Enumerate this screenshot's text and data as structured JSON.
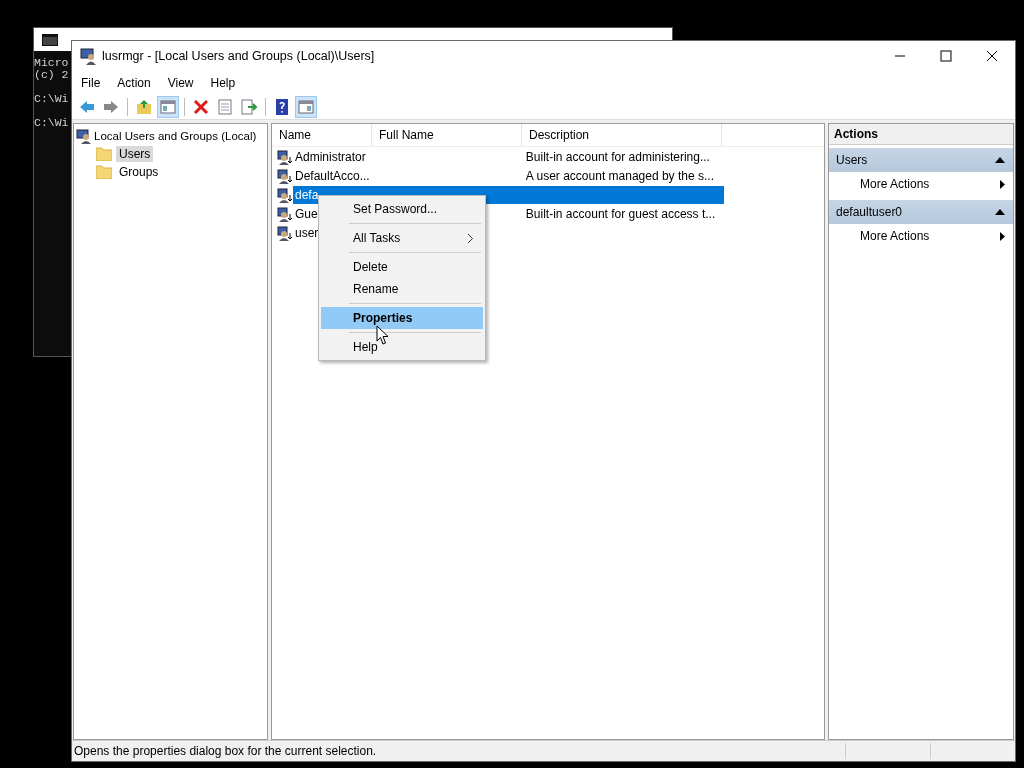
{
  "console_window": {
    "lines": [
      "Micro",
      "(c) 2",
      "C:\\Wi",
      "C:\\Wi"
    ]
  },
  "window": {
    "title": "lusrmgr - [Local Users and Groups (Local)\\Users]"
  },
  "menu_bar": [
    "File",
    "Action",
    "View",
    "Help"
  ],
  "toolbar": [
    {
      "kind": "back",
      "on": false
    },
    {
      "kind": "forward",
      "on": false
    },
    {
      "kind": "separator"
    },
    {
      "kind": "up",
      "on": false
    },
    {
      "kind": "tree-pane",
      "on": true
    },
    {
      "kind": "separator"
    },
    {
      "kind": "delete",
      "on": false
    },
    {
      "kind": "properties",
      "on": false
    },
    {
      "kind": "export",
      "on": false
    },
    {
      "kind": "separator"
    },
    {
      "kind": "help",
      "on": false
    },
    {
      "kind": "action-pane",
      "on": true
    }
  ],
  "tree": {
    "root": "Local Users and Groups (Local)",
    "children": [
      {
        "label": "Users",
        "selected": true
      },
      {
        "label": "Groups",
        "selected": false
      }
    ]
  },
  "list": {
    "columns": [
      "Name",
      "Full Name",
      "Description"
    ],
    "rows": [
      {
        "name": "Administrator",
        "description": "Built-in account for administering...",
        "selected": false
      },
      {
        "name": "DefaultAcco...",
        "description": "A user account managed by the s...",
        "selected": false
      },
      {
        "name": "defa",
        "selected": true
      },
      {
        "name": "Gue",
        "description": "Built-in account for guest access t...",
        "selected": false
      },
      {
        "name": "user",
        "selected": false
      }
    ]
  },
  "context_menu": [
    {
      "kind": "item",
      "label": "Set Password...",
      "selected": false,
      "submenu": false,
      "bold": false
    },
    {
      "kind": "separator"
    },
    {
      "kind": "item",
      "label": "All Tasks",
      "selected": false,
      "submenu": true,
      "bold": false
    },
    {
      "kind": "separator"
    },
    {
      "kind": "item",
      "label": "Delete",
      "selected": false,
      "submenu": false,
      "bold": false
    },
    {
      "kind": "item",
      "label": "Rename",
      "selected": false,
      "submenu": false,
      "bold": false
    },
    {
      "kind": "separator"
    },
    {
      "kind": "item",
      "label": "Properties",
      "selected": true,
      "submenu": false,
      "bold": true
    },
    {
      "kind": "separator"
    },
    {
      "kind": "item",
      "label": "Help",
      "selected": false,
      "submenu": false,
      "bold": false
    }
  ],
  "actions": {
    "title": "Actions",
    "sections": [
      {
        "title": "Users",
        "expanded": true,
        "items": [
          "More Actions"
        ]
      },
      {
        "title": "defaultuser0",
        "expanded": true,
        "items": [
          "More Actions"
        ]
      }
    ]
  },
  "status_bar": "Opens the properties dialog box for the current selection."
}
